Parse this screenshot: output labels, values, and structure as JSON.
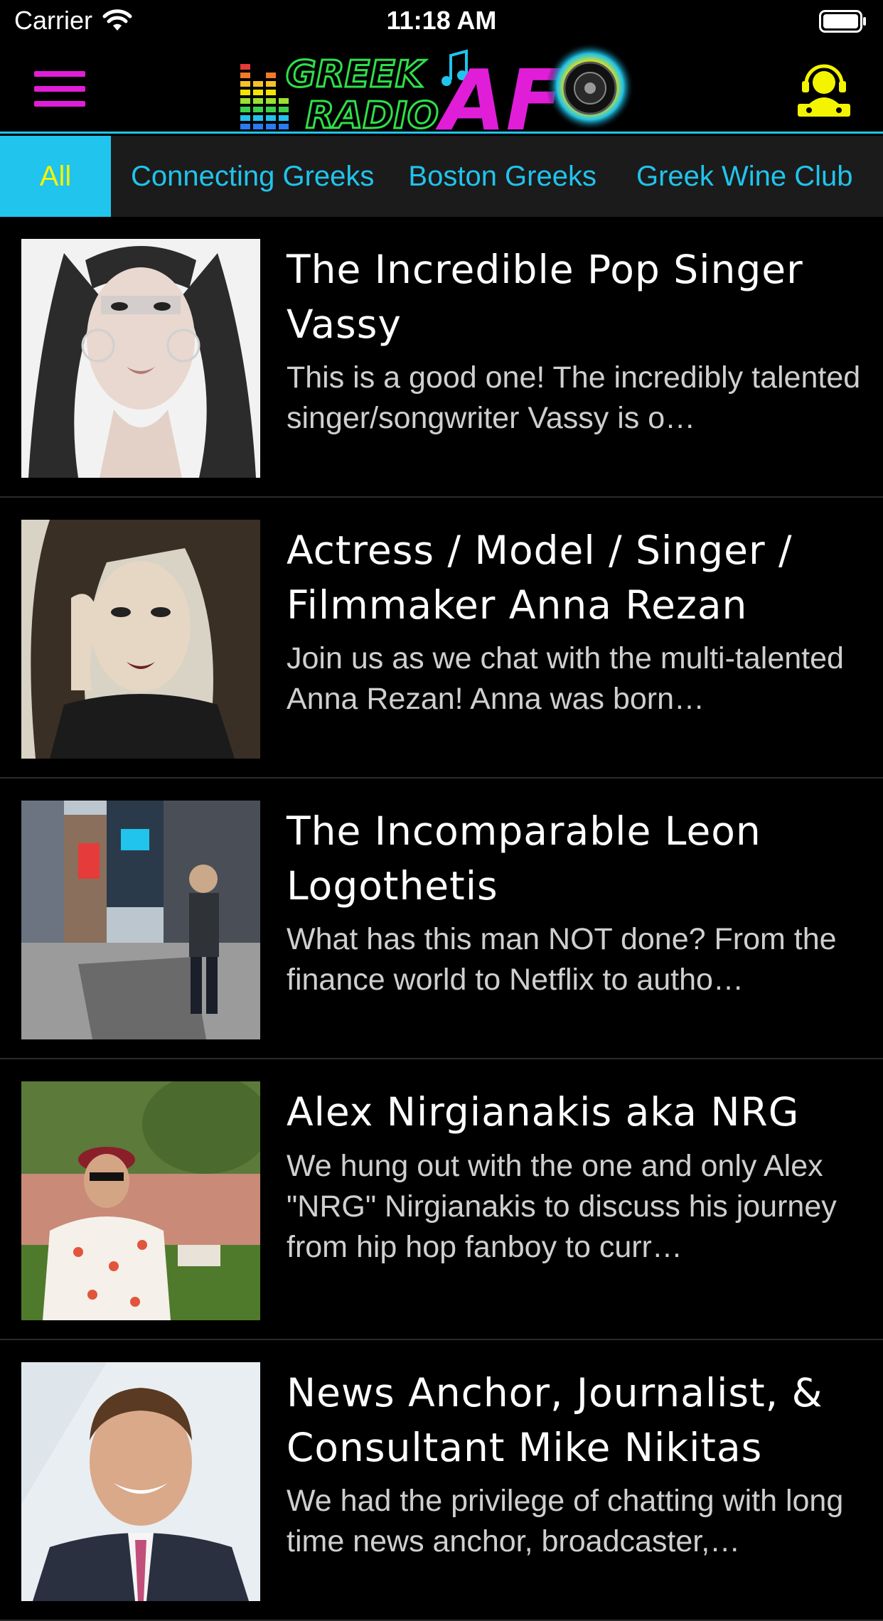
{
  "status_bar": {
    "carrier": "Carrier",
    "time": "11:18 AM"
  },
  "nav": {
    "logo_text_line1": "GREEK",
    "logo_text_line2": "RADIO",
    "logo_text_af": "AF",
    "menu_icon": "hamburger-menu-icon",
    "dj_icon": "dj-headphones-icon"
  },
  "colors": {
    "accent_cyan": "#20c4ec",
    "accent_yellow": "#f4f400",
    "accent_magenta": "#e01ed8",
    "background": "#000000"
  },
  "tabs": [
    {
      "label": "All",
      "active": true
    },
    {
      "label": "Connecting Greeks",
      "active": false
    },
    {
      "label": "Boston Greeks",
      "active": false
    },
    {
      "label": "Greek Wine Club",
      "active": false
    }
  ],
  "episodes": [
    {
      "title": "The Incredible Pop Singer Vassy",
      "description": "This is a good one! The incredibly talented singer/songwriter Vassy is o…"
    },
    {
      "title": "Actress / Model / Singer / Filmmaker Anna Rezan",
      "description": "Join us as we chat with the multi-talented Anna Rezan! Anna was born…"
    },
    {
      "title": "The Incomparable Leon Logothetis",
      "description": "What has this man NOT done? From the finance world to Netflix to autho…"
    },
    {
      "title": "Alex Nirgianakis aka NRG",
      "description": "We hung out with the one and only Alex \"NRG\" Nirgianakis to discuss his journey from hip hop fanboy to curr…"
    },
    {
      "title": "News Anchor, Journalist, & Consultant Mike Nikitas",
      "description": "We had the privilege of chatting with long time news anchor, broadcaster,…"
    }
  ]
}
